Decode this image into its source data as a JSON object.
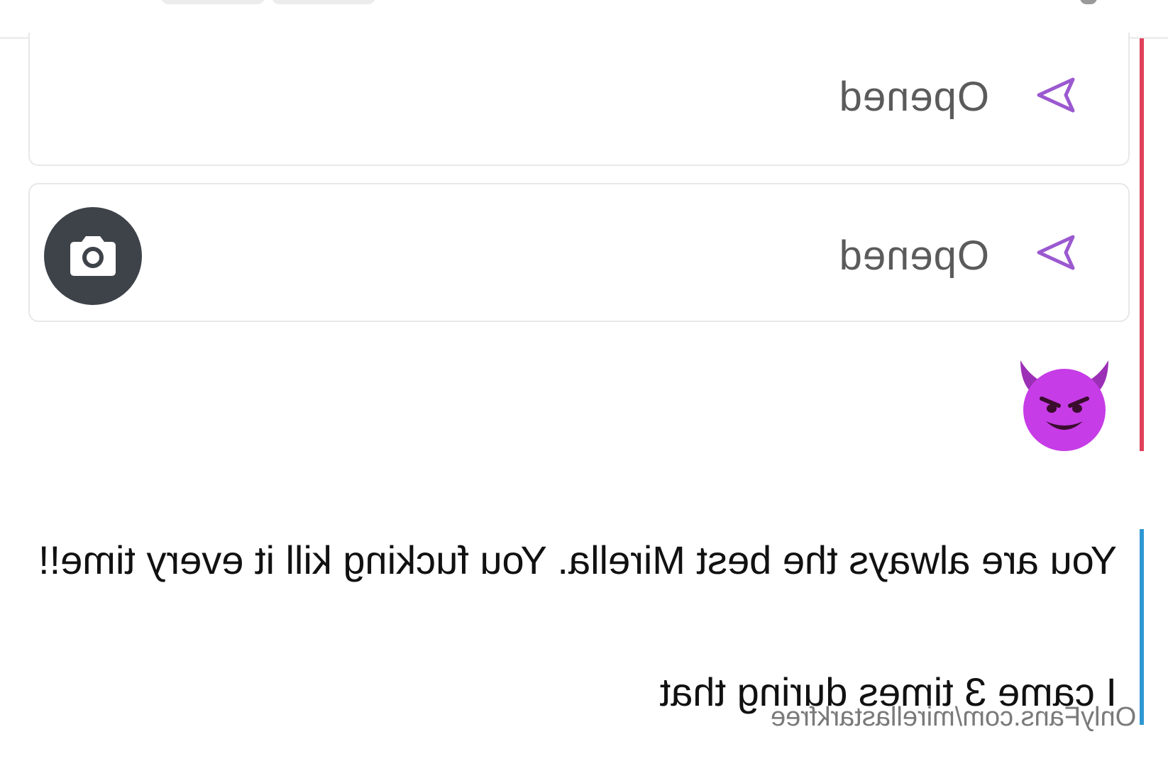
{
  "snaps": [
    {
      "status": "Opened",
      "icon": "send-arrow-icon",
      "has_media": false
    },
    {
      "status": "Opened",
      "icon": "send-arrow-icon",
      "has_media": true,
      "media_icon": "camera-icon"
    }
  ],
  "emoji_message": {
    "icon": "smiling-devil-emoji-icon"
  },
  "messages": [
    "You are always the best Mirella. You fucking kill it every time!!",
    "I came 3 times during that"
  ],
  "watermark": "OnlyFans.com/mirellastarkfree",
  "colors": {
    "accent_purple": "#9b59d0",
    "sender_red": "#e0405a",
    "sender_blue": "#2f97d3",
    "camera_bg": "#3e434a",
    "devil_magenta": "#c63ce6"
  }
}
